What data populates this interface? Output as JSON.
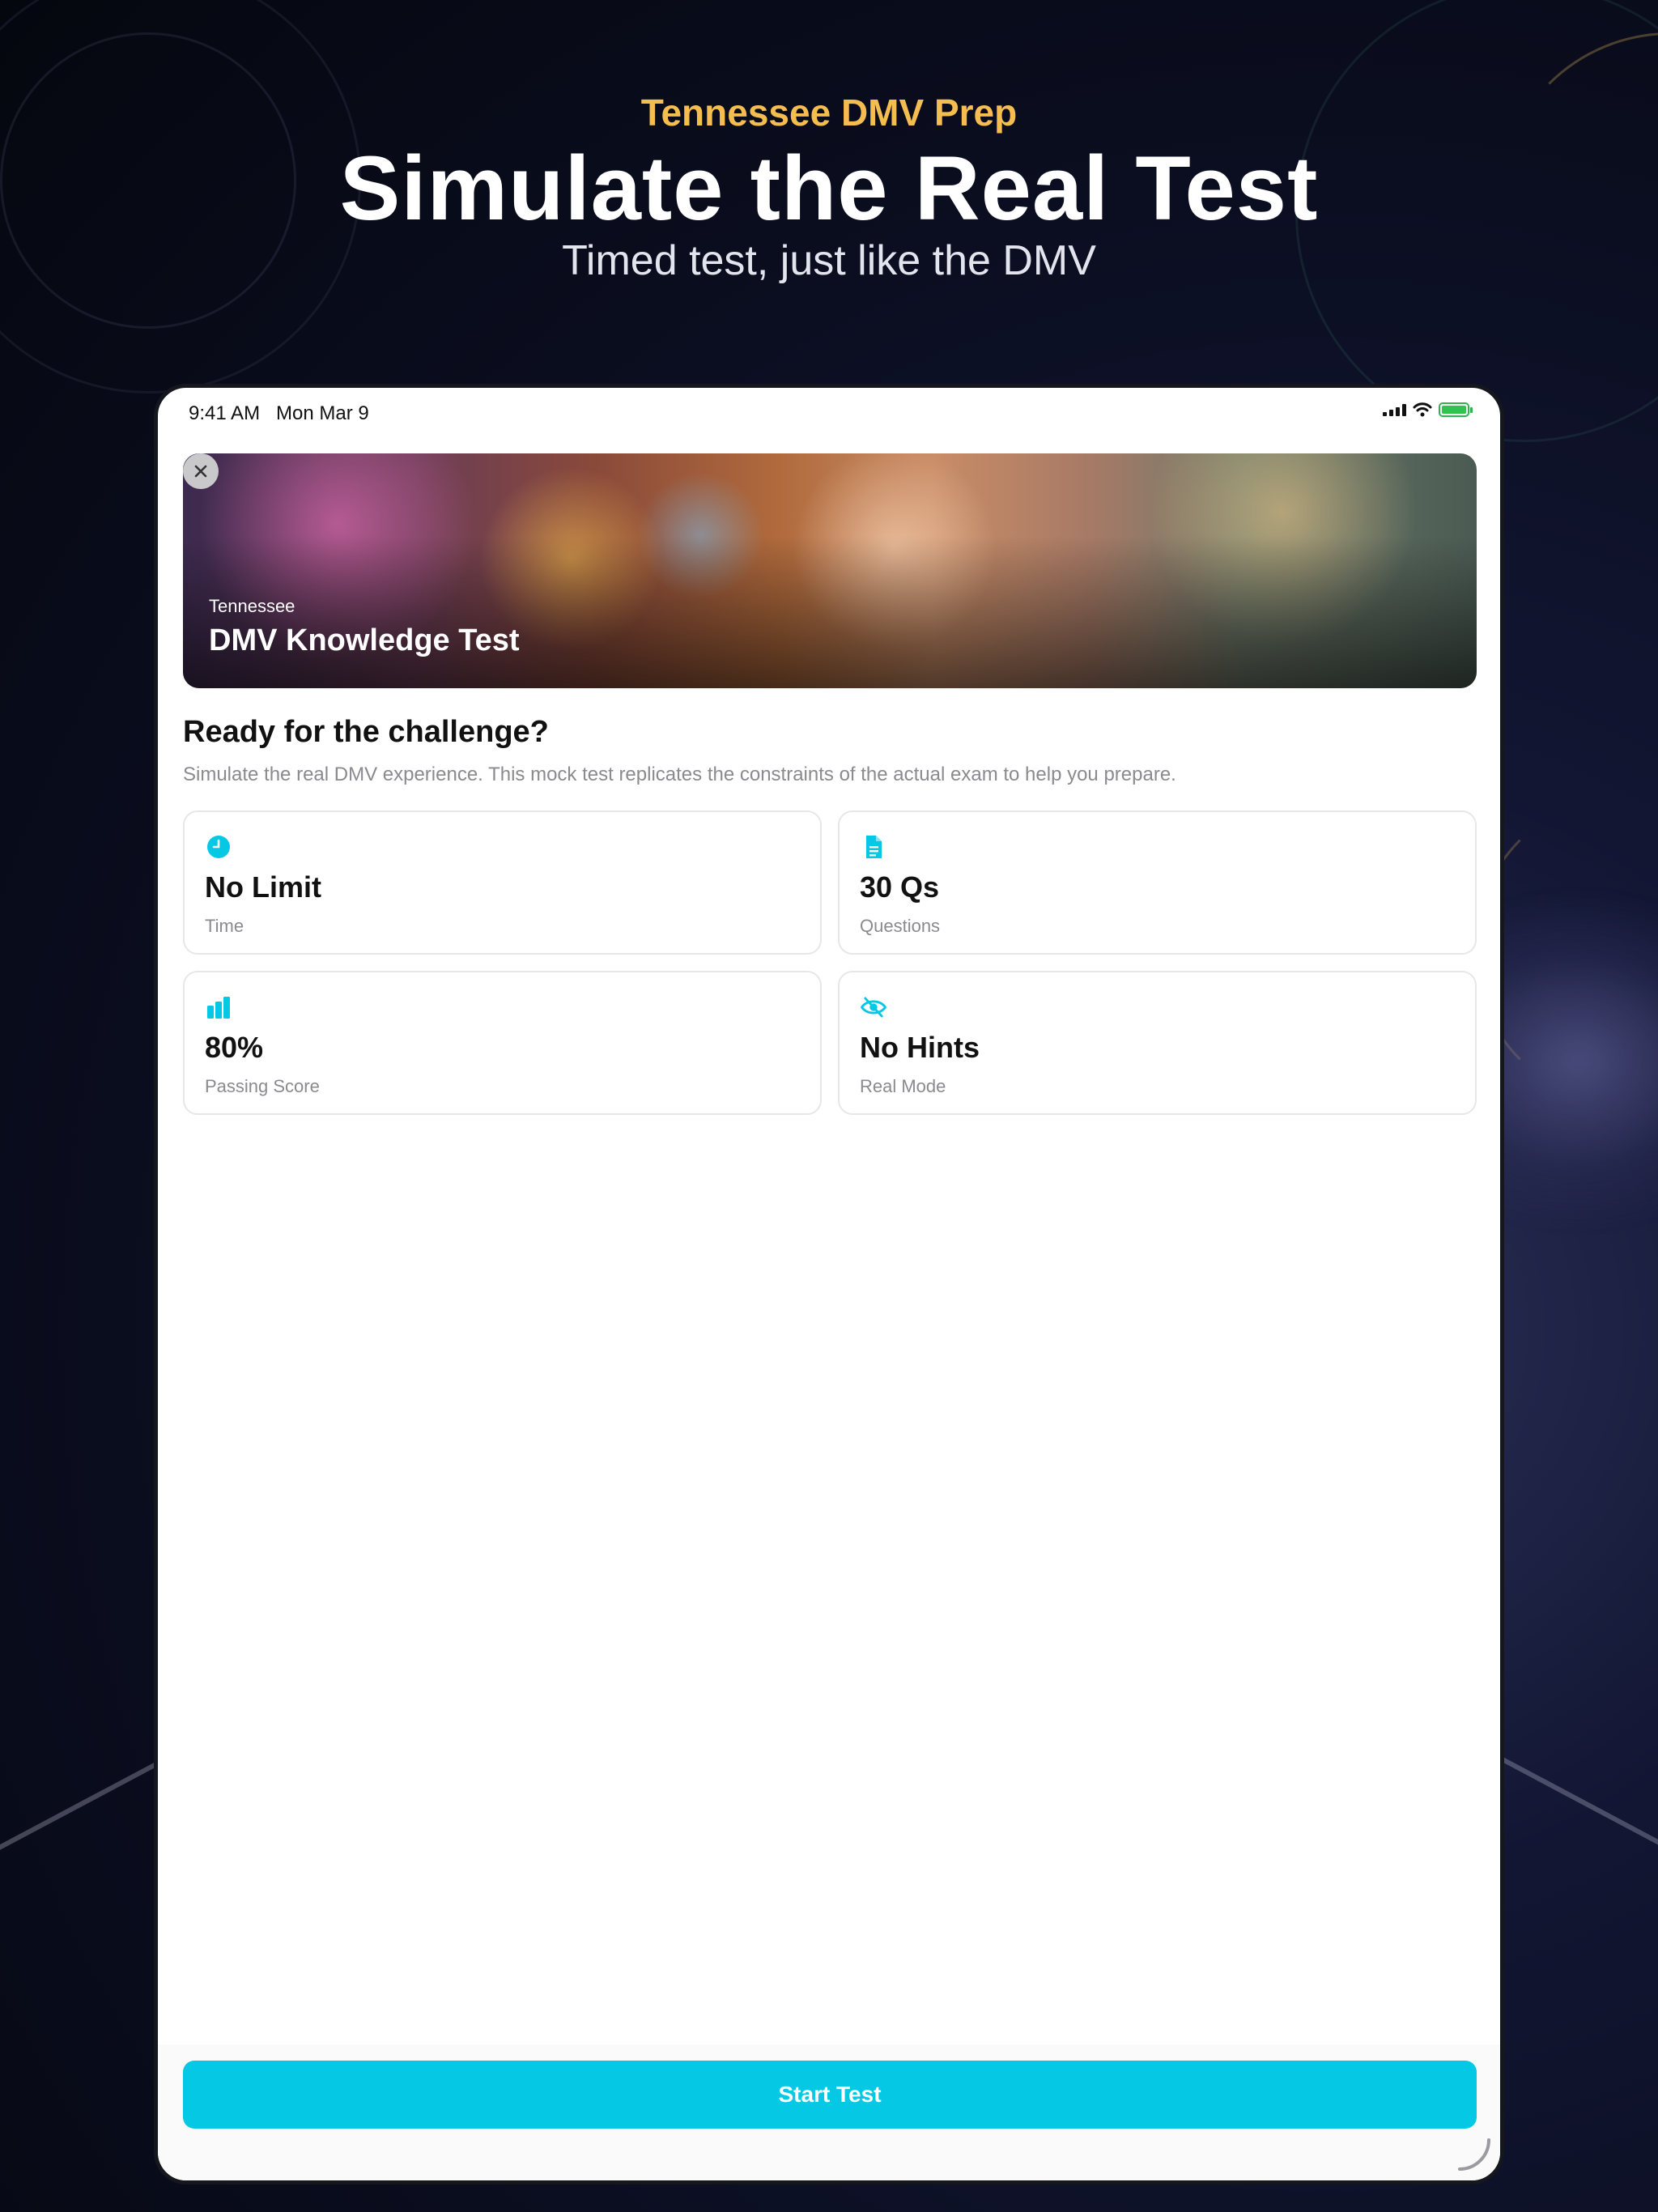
{
  "hero": {
    "kicker": "Tennessee DMV Prep",
    "title": "Simulate the Real Test",
    "subtitle": "Timed test, just like the DMV"
  },
  "status_bar": {
    "time": "9:41 AM   Mon Mar 9",
    "icons": [
      "cellular-signal-icon",
      "wifi-icon",
      "battery-charging-icon"
    ]
  },
  "banner": {
    "state": "Tennessee",
    "title": "DMV Knowledge Test",
    "close_icon": "close-icon"
  },
  "intro": {
    "title": "Ready for the challenge?",
    "description": "Simulate the real DMV experience. This mock test replicates the constraints of the actual exam to help you prepare."
  },
  "cards": [
    {
      "icon": "clock-icon",
      "value": "No Limit",
      "label": "Time"
    },
    {
      "icon": "document-icon",
      "value": "30 Qs",
      "label": "Questions"
    },
    {
      "icon": "bar-chart-icon",
      "value": "80%",
      "label": "Passing Score"
    },
    {
      "icon": "eye-slash-icon",
      "value": "No Hints",
      "label": "Real Mode"
    }
  ],
  "footer": {
    "start_label": "Start Test"
  },
  "colors": {
    "accent": "#05c8e4",
    "kicker": "#f5bd4f",
    "battery": "#33c24d"
  }
}
